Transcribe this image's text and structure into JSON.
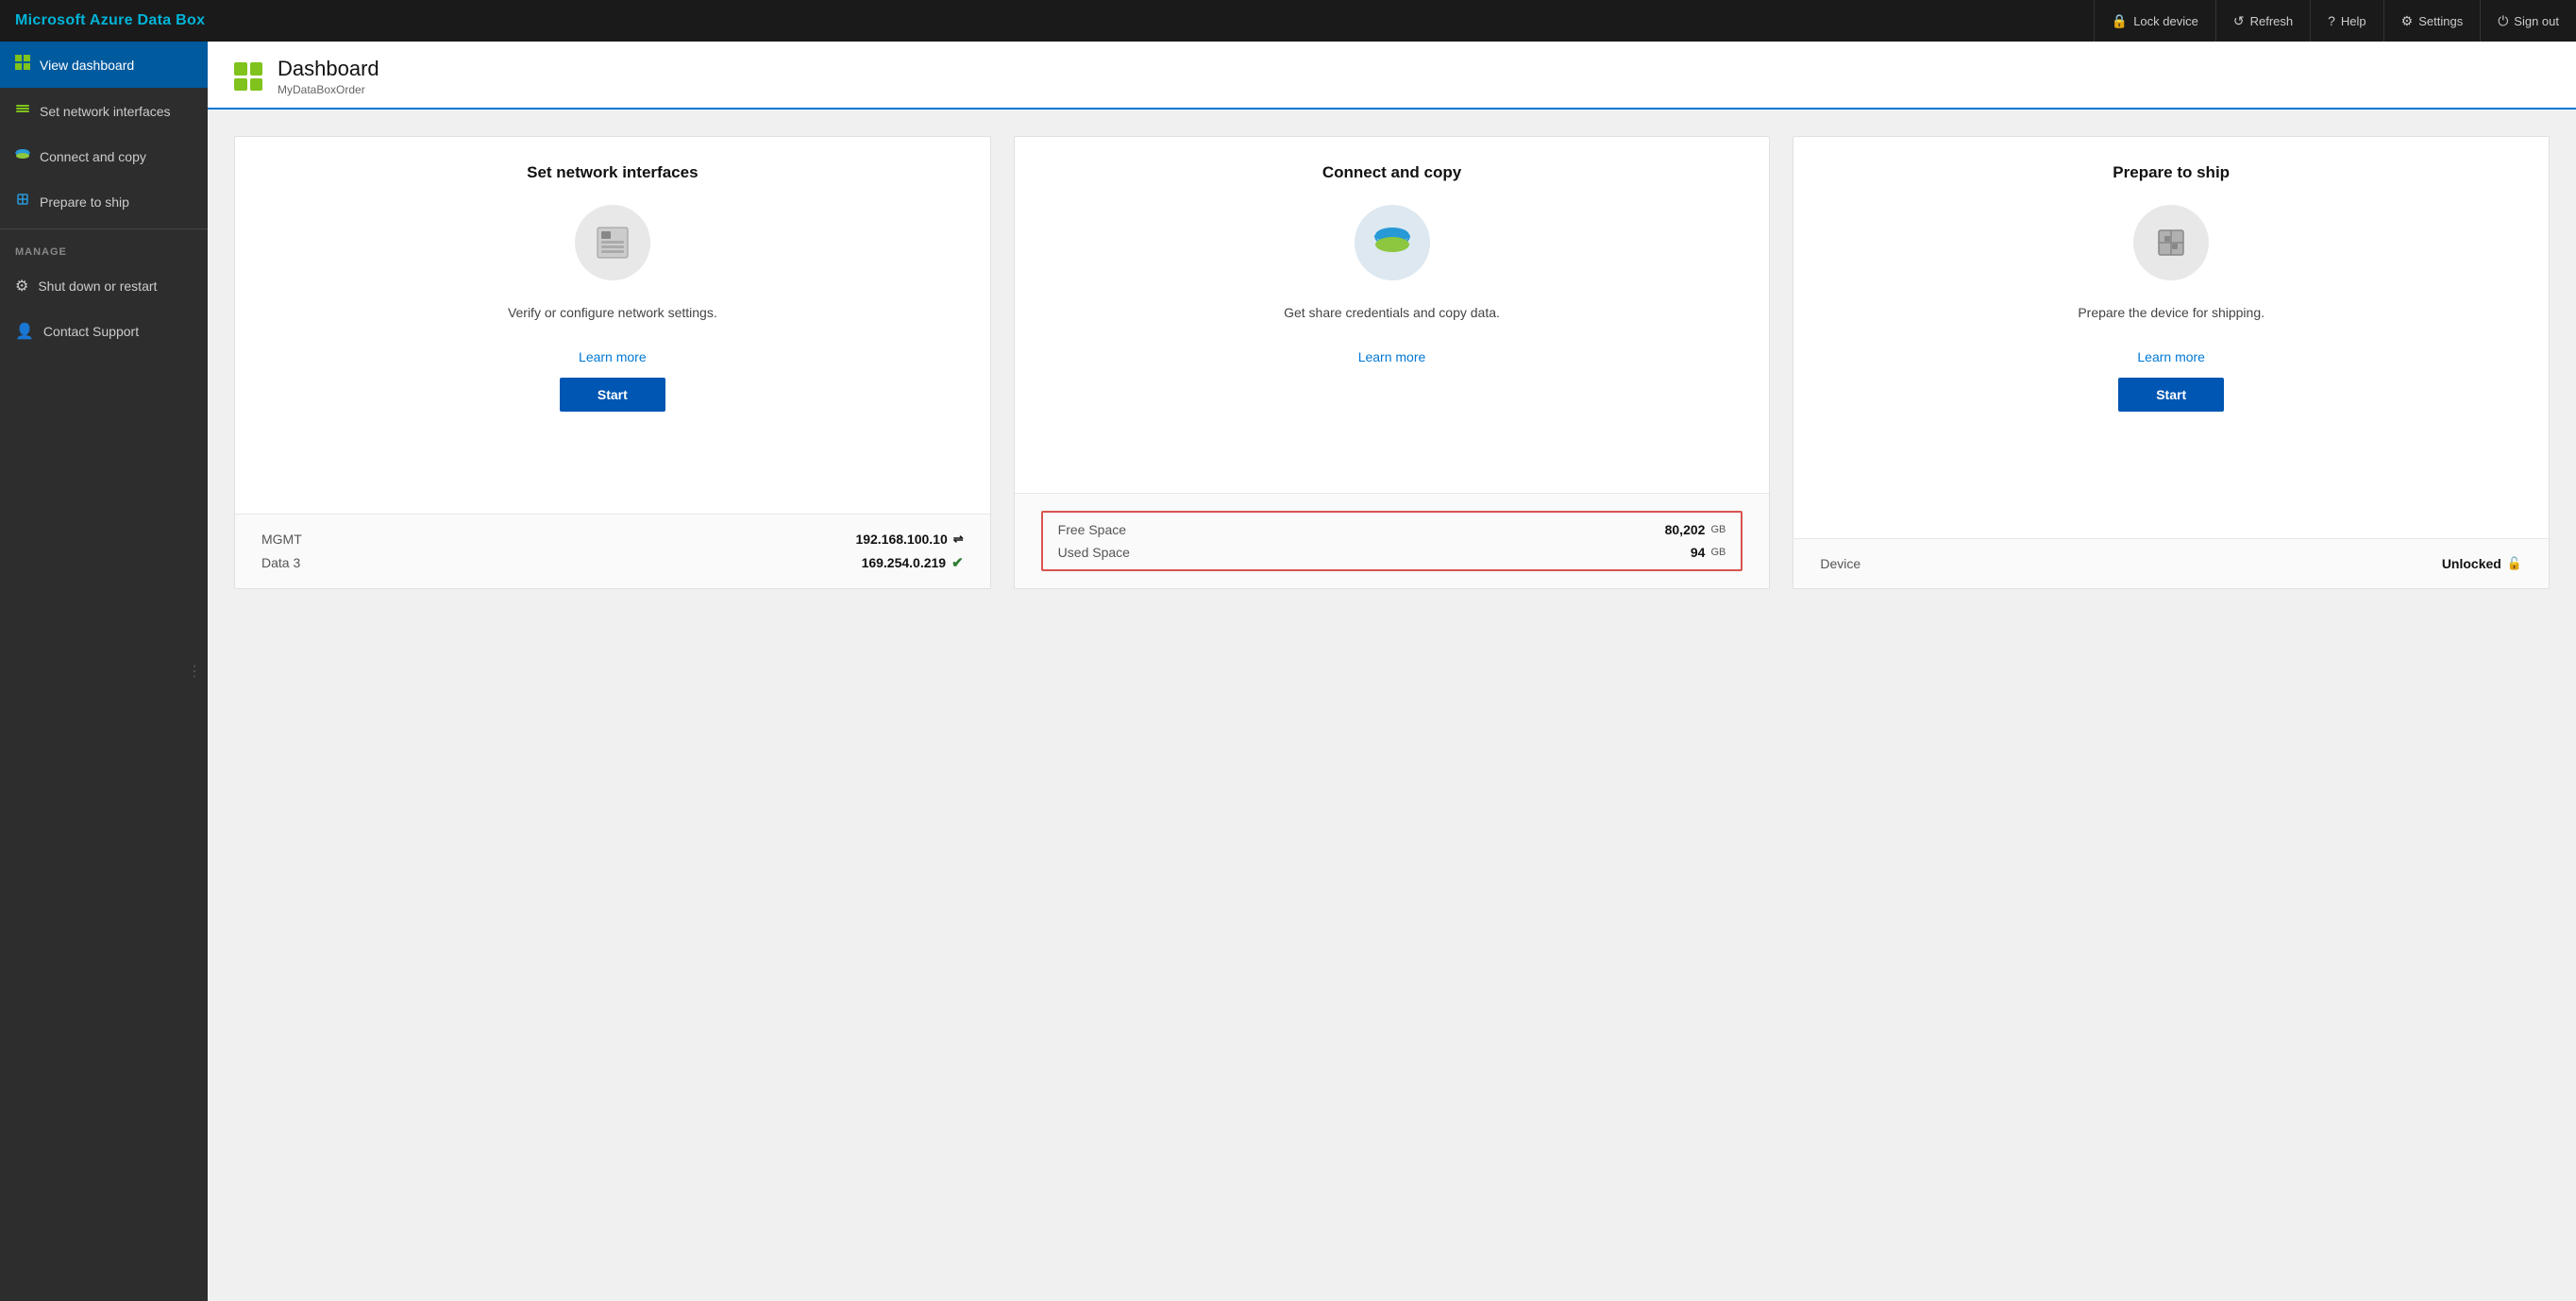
{
  "brand": "Microsoft Azure Data Box",
  "topbar": {
    "actions": [
      {
        "id": "lock-device",
        "icon": "🔒",
        "label": "Lock device"
      },
      {
        "id": "refresh",
        "icon": "↺",
        "label": "Refresh"
      },
      {
        "id": "help",
        "icon": "?",
        "label": "Help"
      },
      {
        "id": "settings",
        "icon": "⚙",
        "label": "Settings"
      },
      {
        "id": "sign-out",
        "icon": "⏻",
        "label": "Sign out"
      }
    ]
  },
  "sidebar": {
    "items": [
      {
        "id": "view-dashboard",
        "icon": "⊞",
        "label": "View dashboard",
        "active": true
      },
      {
        "id": "set-network-interfaces",
        "icon": "◧",
        "label": "Set network interfaces",
        "active": false
      },
      {
        "id": "connect-and-copy",
        "icon": "⏸",
        "label": "Connect and copy",
        "active": false
      },
      {
        "id": "prepare-to-ship",
        "icon": "🎁",
        "label": "Prepare to ship",
        "active": false
      }
    ],
    "manage_label": "MANAGE",
    "manage_items": [
      {
        "id": "shut-down-restart",
        "icon": "⚙",
        "label": "Shut down or restart",
        "active": false
      },
      {
        "id": "contact-support",
        "icon": "👤",
        "label": "Contact Support",
        "active": false
      }
    ]
  },
  "page": {
    "title": "Dashboard",
    "subtitle": "MyDataBoxOrder"
  },
  "cards": [
    {
      "id": "network-card",
      "title": "Set network interfaces",
      "description": "Verify or configure network settings.",
      "learn_more_label": "Learn more",
      "start_label": "Start",
      "bottom_rows": [
        {
          "label": "MGMT",
          "value": "192.168.100.10",
          "extra": "⇌",
          "highlighted": false
        },
        {
          "label": "Data 3",
          "value": "169.254.0.219",
          "extra": "✔",
          "extra_class": "status-connected",
          "highlighted": false
        }
      ],
      "bottom_highlighted": false
    },
    {
      "id": "copy-card",
      "title": "Connect and copy",
      "description": "Get share credentials and copy data.",
      "learn_more_label": "Learn more",
      "start_label": null,
      "bottom_rows": [
        {
          "label": "Free Space",
          "value": "80,202",
          "unit": "GB"
        },
        {
          "label": "Used Space",
          "value": "94",
          "unit": "GB"
        }
      ],
      "bottom_highlighted": true
    },
    {
      "id": "ship-card",
      "title": "Prepare to ship",
      "description": "Prepare the device for shipping.",
      "learn_more_label": "Learn more",
      "start_label": "Start",
      "bottom_rows": [
        {
          "label": "Device",
          "value": "Unlocked",
          "unit": "",
          "extra": "🔓"
        }
      ],
      "bottom_highlighted": false
    }
  ]
}
